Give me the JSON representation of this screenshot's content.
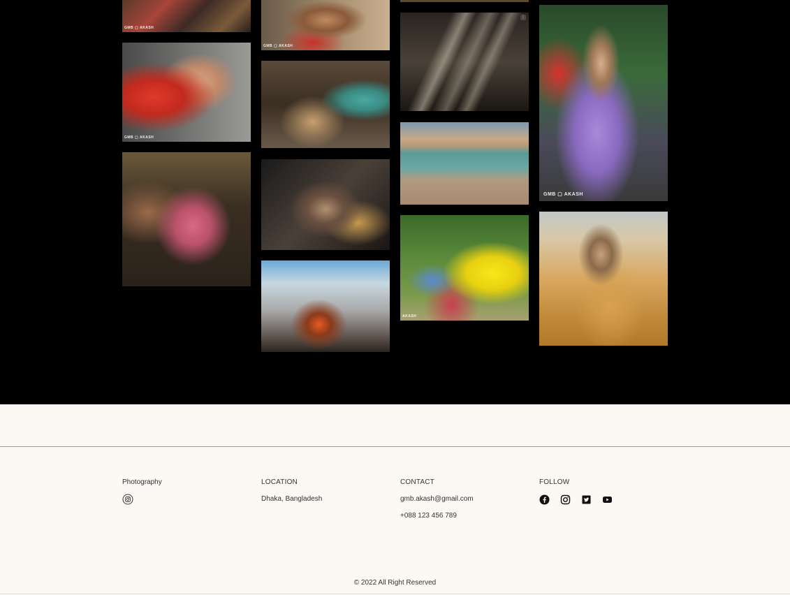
{
  "gallery": {
    "photos": [
      {
        "caption": "",
        "watermark": "GMB ▢ AKASH"
      },
      {
        "caption": "",
        "watermark": "GMB ▢ AKASH"
      },
      {
        "caption": "",
        "watermark": ""
      },
      {
        "caption": "",
        "watermark": "GMB ▢ AKASH"
      },
      {
        "caption": "",
        "watermark": ""
      },
      {
        "caption": "",
        "watermark": ""
      },
      {
        "caption": "",
        "watermark": ""
      },
      {
        "caption": "",
        "watermark": ""
      },
      {
        "caption": "",
        "watermark": ""
      },
      {
        "caption": "",
        "watermark": "AKASH"
      },
      {
        "caption": "",
        "watermark": "GMB ▢ AKASH"
      },
      {
        "caption": "",
        "watermark": ""
      },
      {
        "caption": "",
        "watermark": ""
      },
      {
        "caption": "",
        "watermark": ""
      }
    ]
  },
  "footer": {
    "brand": {
      "label": "Photography",
      "icon": "instagram-outline-icon"
    },
    "location": {
      "heading": "LOCATION",
      "value": "Dhaka, Bangladesh"
    },
    "contact": {
      "heading": "CONTACT",
      "email": "gmb.akash@gmail.com",
      "phone": "+088 123 456 789"
    },
    "follow": {
      "heading": "FOLLOW",
      "icons": [
        "facebook-icon",
        "instagram-icon",
        "twitter-icon",
        "youtube-icon"
      ]
    },
    "copyright": "© 2022 All Right Reserved"
  },
  "colors": {
    "gallery_bg": "#000000",
    "footer_bg": "#fcf8f3",
    "text": "#333333",
    "icon": "#111111"
  }
}
